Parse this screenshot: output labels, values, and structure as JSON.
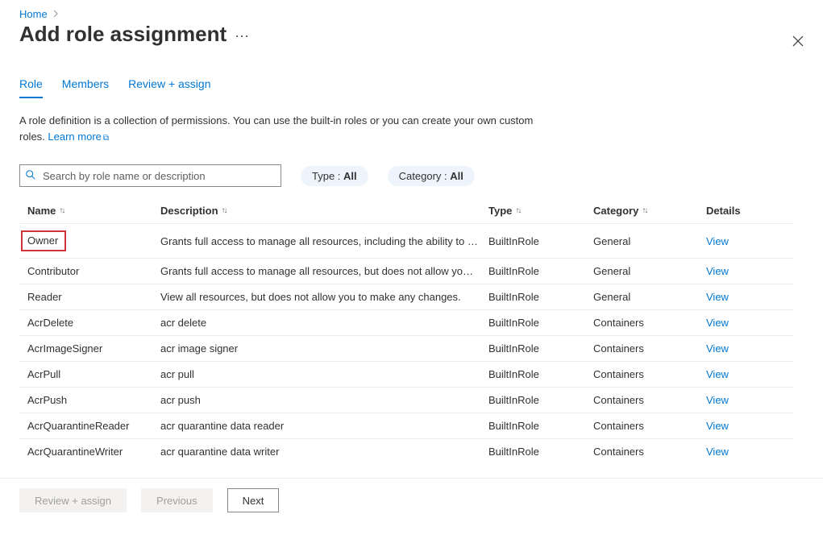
{
  "breadcrumb": {
    "home": "Home"
  },
  "page": {
    "title": "Add role assignment"
  },
  "tabs": {
    "role": "Role",
    "members": "Members",
    "review": "Review + assign"
  },
  "intro": {
    "text": "A role definition is a collection of permissions. You can use the built-in roles or you can create your own custom roles. ",
    "learn_more": "Learn more"
  },
  "search": {
    "placeholder": "Search by role name or description"
  },
  "filters": {
    "type_label": "Type : ",
    "type_value": "All",
    "category_label": "Category : ",
    "category_value": "All"
  },
  "columns": {
    "name": "Name",
    "description": "Description",
    "type": "Type",
    "category": "Category",
    "details": "Details"
  },
  "rows": [
    {
      "name": "Owner",
      "description": "Grants full access to manage all resources, including the ability to assign roles in Azure RBAC.",
      "type": "BuiltInRole",
      "category": "General",
      "view": "View",
      "highlight": true
    },
    {
      "name": "Contributor",
      "description": "Grants full access to manage all resources, but does not allow you to assign roles.",
      "type": "BuiltInRole",
      "category": "General",
      "view": "View"
    },
    {
      "name": "Reader",
      "description": "View all resources, but does not allow you to make any changes.",
      "type": "BuiltInRole",
      "category": "General",
      "view": "View"
    },
    {
      "name": "AcrDelete",
      "description": "acr delete",
      "type": "BuiltInRole",
      "category": "Containers",
      "view": "View"
    },
    {
      "name": "AcrImageSigner",
      "description": "acr image signer",
      "type": "BuiltInRole",
      "category": "Containers",
      "view": "View"
    },
    {
      "name": "AcrPull",
      "description": "acr pull",
      "type": "BuiltInRole",
      "category": "Containers",
      "view": "View"
    },
    {
      "name": "AcrPush",
      "description": "acr push",
      "type": "BuiltInRole",
      "category": "Containers",
      "view": "View"
    },
    {
      "name": "AcrQuarantineReader",
      "description": "acr quarantine data reader",
      "type": "BuiltInRole",
      "category": "Containers",
      "view": "View"
    },
    {
      "name": "AcrQuarantineWriter",
      "description": "acr quarantine data writer",
      "type": "BuiltInRole",
      "category": "Containers",
      "view": "View"
    }
  ],
  "footer": {
    "review": "Review + assign",
    "previous": "Previous",
    "next": "Next"
  }
}
